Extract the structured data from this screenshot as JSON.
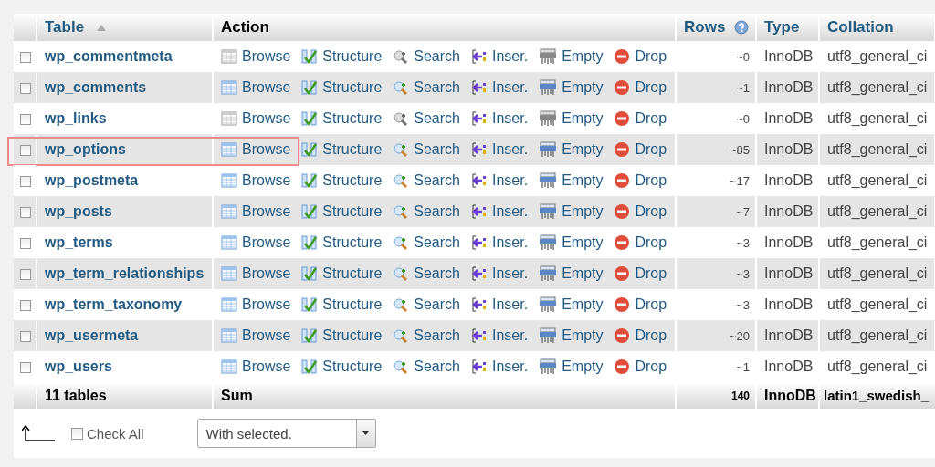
{
  "table": {
    "columns": [
      {
        "label": "Table",
        "sorted_ascending": true
      },
      {
        "label": "Action"
      },
      {
        "label": "Rows",
        "help": true
      },
      {
        "label": "Type"
      },
      {
        "label": "Collation"
      }
    ],
    "rows": [
      {
        "name": "wp_commentmeta",
        "checked": false,
        "icons_active": false,
        "highlighted": false,
        "actions": [
          "Browse",
          "Structure",
          "Search",
          "Inser.",
          "Empty",
          "Drop"
        ],
        "rows": "~0",
        "type": "InnoDB",
        "collation": "utf8_general_ci"
      },
      {
        "name": "wp_comments",
        "checked": false,
        "icons_active": true,
        "highlighted": false,
        "actions": [
          "Browse",
          "Structure",
          "Search",
          "Inser.",
          "Empty",
          "Drop"
        ],
        "rows": "~1",
        "type": "InnoDB",
        "collation": "utf8_general_ci"
      },
      {
        "name": "wp_links",
        "checked": false,
        "icons_active": false,
        "highlighted": false,
        "actions": [
          "Browse",
          "Structure",
          "Search",
          "Inser.",
          "Empty",
          "Drop"
        ],
        "rows": "~0",
        "type": "InnoDB",
        "collation": "utf8_general_ci"
      },
      {
        "name": "wp_options",
        "checked": false,
        "icons_active": true,
        "highlighted": true,
        "actions": [
          "Browse",
          "Structure",
          "Search",
          "Inser.",
          "Empty",
          "Drop"
        ],
        "rows": "~85",
        "type": "InnoDB",
        "collation": "utf8_general_ci"
      },
      {
        "name": "wp_postmeta",
        "checked": false,
        "icons_active": true,
        "highlighted": false,
        "actions": [
          "Browse",
          "Structure",
          "Search",
          "Inser.",
          "Empty",
          "Drop"
        ],
        "rows": "~17",
        "type": "InnoDB",
        "collation": "utf8_general_ci"
      },
      {
        "name": "wp_posts",
        "checked": false,
        "icons_active": true,
        "highlighted": false,
        "actions": [
          "Browse",
          "Structure",
          "Search",
          "Inser.",
          "Empty",
          "Drop"
        ],
        "rows": "~7",
        "type": "InnoDB",
        "collation": "utf8_general_ci"
      },
      {
        "name": "wp_terms",
        "checked": false,
        "icons_active": true,
        "highlighted": false,
        "actions": [
          "Browse",
          "Structure",
          "Search",
          "Inser.",
          "Empty",
          "Drop"
        ],
        "rows": "~3",
        "type": "InnoDB",
        "collation": "utf8_general_ci"
      },
      {
        "name": "wp_term_relationships",
        "checked": false,
        "icons_active": true,
        "highlighted": false,
        "actions": [
          "Browse",
          "Structure",
          "Search",
          "Inser.",
          "Empty",
          "Drop"
        ],
        "rows": "~3",
        "type": "InnoDB",
        "collation": "utf8_general_ci"
      },
      {
        "name": "wp_term_taxonomy",
        "checked": false,
        "icons_active": true,
        "highlighted": false,
        "actions": [
          "Browse",
          "Structure",
          "Search",
          "Inser.",
          "Empty",
          "Drop"
        ],
        "rows": "~3",
        "type": "InnoDB",
        "collation": "utf8_general_ci"
      },
      {
        "name": "wp_usermeta",
        "checked": false,
        "icons_active": true,
        "highlighted": false,
        "actions": [
          "Browse",
          "Structure",
          "Search",
          "Inser.",
          "Empty",
          "Drop"
        ],
        "rows": "~20",
        "type": "InnoDB",
        "collation": "utf8_general_ci"
      },
      {
        "name": "wp_users",
        "checked": false,
        "icons_active": true,
        "highlighted": false,
        "actions": [
          "Browse",
          "Structure",
          "Search",
          "Inser.",
          "Empty",
          "Drop"
        ],
        "rows": "~1",
        "type": "InnoDB",
        "collation": "utf8_general_ci"
      }
    ],
    "footer": {
      "count": "11 tables",
      "label": "Sum",
      "rows": "140",
      "type": "InnoDB",
      "collation": "latin1_swedish_"
    }
  },
  "bulk": {
    "check_all": {
      "label": "Check All",
      "checked": false
    },
    "select": {
      "value": "With selected."
    }
  }
}
